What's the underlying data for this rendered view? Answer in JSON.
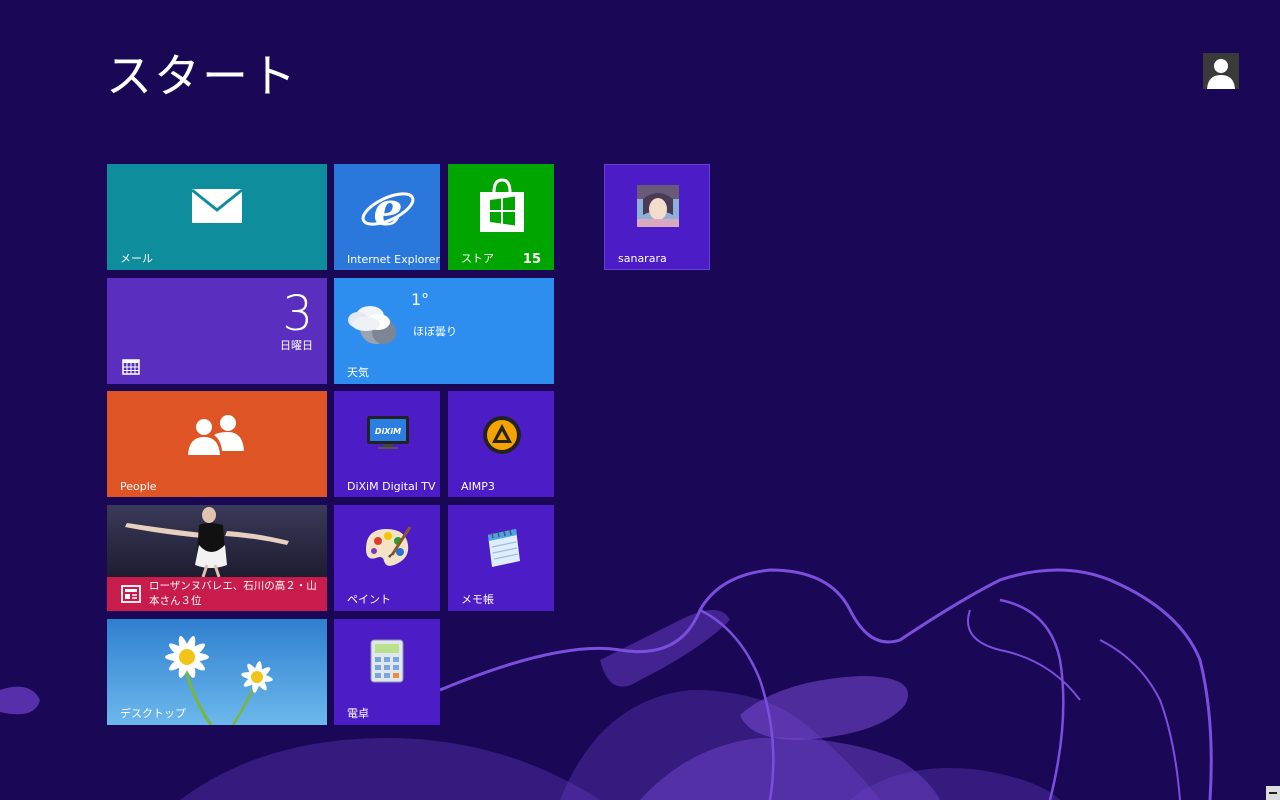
{
  "header": {
    "title": "スタート"
  },
  "tiles": {
    "mail": {
      "label": "メール"
    },
    "ie": {
      "label": "Internet Explorer"
    },
    "store": {
      "label": "ストア",
      "badge": "15"
    },
    "user": {
      "label": "sanarara"
    },
    "calendar": {
      "day": "3",
      "weekday": "日曜日"
    },
    "weather": {
      "label": "天気",
      "temperature": "1°",
      "condition": "ほぼ曇り"
    },
    "people": {
      "label": "People"
    },
    "dixim": {
      "label": "DiXiM Digital TV",
      "logo_text": "DiXiM"
    },
    "aimp": {
      "label": "AIMP3"
    },
    "news": {
      "headline": "ローザンヌバレエ、石川の高２・山本さん３位"
    },
    "paint": {
      "label": "ペイント"
    },
    "memo": {
      "label": "メモ帳"
    },
    "desktop": {
      "label": "デスクトップ"
    },
    "calc": {
      "label": "電卓"
    }
  },
  "colors": {
    "background": "#1a0856",
    "mail": "#0e8d9c",
    "ie": "#2b78dd",
    "store": "#00a500",
    "app_tile": "#4c1cc6",
    "calendar": "#5a2fc0",
    "weather": "#2e8ef0",
    "people": "#df5425",
    "news_bar": "#c81d4c"
  },
  "icons": {
    "mail": "envelope-icon",
    "ie": "internet-explorer-icon",
    "store": "store-bag-icon",
    "calendar": "calendar-grid-icon",
    "weather": "cloud-icon",
    "people": "people-icon",
    "dixim": "tv-icon",
    "aimp": "aimp-icon",
    "news": "newspaper-icon",
    "paint": "palette-icon",
    "memo": "notepad-icon",
    "calc": "calculator-icon",
    "account": "user-avatar-icon"
  }
}
